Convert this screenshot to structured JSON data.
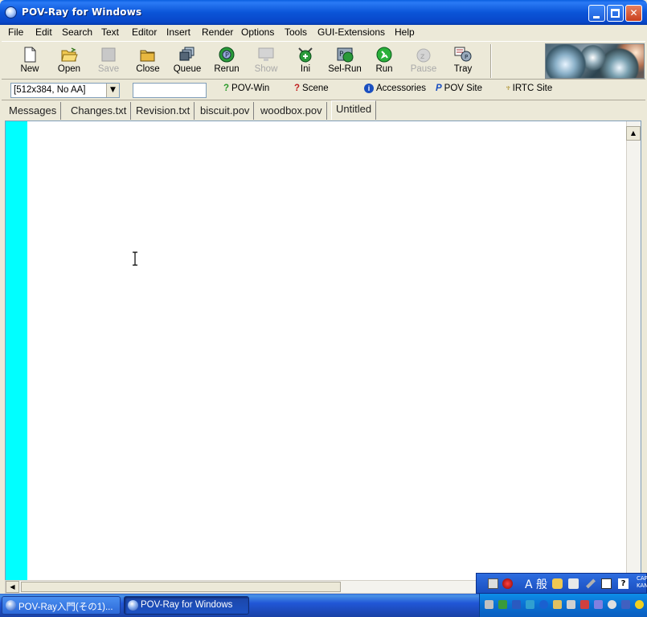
{
  "window": {
    "title": "POV-Ray for Windows"
  },
  "menu": [
    "File",
    "Edit",
    "Search",
    "Text",
    "Editor",
    "Insert",
    "Render",
    "Options",
    "Tools",
    "GUI-Extensions",
    "Help"
  ],
  "toolbar": {
    "buttons": [
      {
        "label": "New",
        "icon": "new-file-icon",
        "disabled": false
      },
      {
        "label": "Open",
        "icon": "open-folder-icon",
        "disabled": false
      },
      {
        "label": "Save",
        "icon": "save-icon",
        "disabled": true
      },
      {
        "label": "Close",
        "icon": "close-folder-icon",
        "disabled": false
      },
      {
        "label": "Queue",
        "icon": "queue-icon",
        "disabled": false
      },
      {
        "label": "Rerun",
        "icon": "rerun-icon",
        "disabled": false
      },
      {
        "label": "Show",
        "icon": "show-icon",
        "disabled": true
      },
      {
        "label": "Ini",
        "icon": "ini-icon",
        "disabled": false
      },
      {
        "label": "Sel-Run",
        "icon": "sel-run-icon",
        "disabled": false
      },
      {
        "label": "Run",
        "icon": "run-icon",
        "disabled": false
      },
      {
        "label": "Pause",
        "icon": "pause-icon",
        "disabled": true
      },
      {
        "label": "Tray",
        "icon": "tray-icon",
        "disabled": false
      }
    ]
  },
  "bar2": {
    "resolution": "[512x384, No AA]",
    "command_value": "",
    "links": [
      {
        "label": "POV-Win",
        "icon": "help-icon"
      },
      {
        "label": "Scene",
        "icon": "help-icon"
      },
      {
        "label": "Accessories",
        "icon": "info-icon"
      },
      {
        "label": "POV Site",
        "icon": "pov-icon"
      },
      {
        "label": "IRTC Site",
        "icon": "trophy-icon"
      }
    ]
  },
  "tabs": [
    {
      "label": "Messages",
      "active": false
    },
    {
      "label": "Changes.txt",
      "active": false
    },
    {
      "label": "Revision.txt",
      "active": false
    },
    {
      "label": "biscuit.pov",
      "active": false
    },
    {
      "label": "woodbox.pov",
      "active": false
    },
    {
      "label": "Untitled",
      "active": true
    }
  ],
  "taskbar": {
    "tasks": [
      {
        "label": "POV-Ray入門(その1)..."
      },
      {
        "label": "POV-Ray for Windows"
      }
    ]
  },
  "langbar": {
    "text": "A 般",
    "caps": "CAPS KANA"
  },
  "colors": {
    "gutter": "#00ffff",
    "titlebar": "#0a5fe0"
  }
}
